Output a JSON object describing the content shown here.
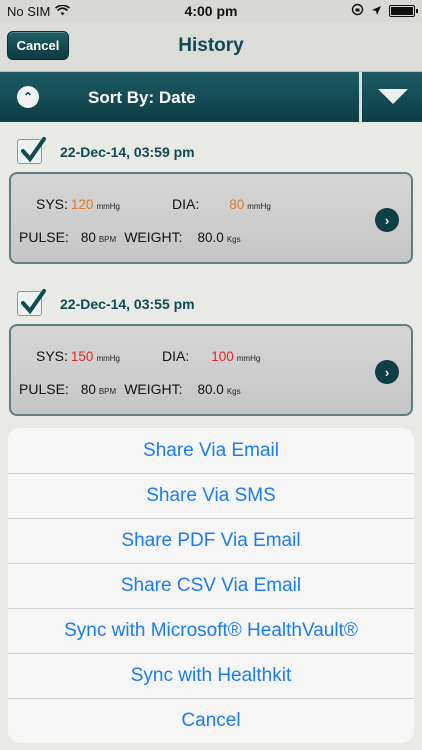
{
  "status": {
    "carrier": "No SIM",
    "time": "4:00 pm"
  },
  "nav": {
    "cancel_label": "Cancel",
    "title": "History"
  },
  "sort": {
    "label": "Sort By: Date"
  },
  "entries": [
    {
      "date": "22-Dec-14, 03:59 pm",
      "sys_label": "SYS:",
      "sys_value": "120",
      "sys_unit": "mmHg",
      "dia_label": "DIA:",
      "dia_value": "80",
      "dia_unit": "mmHg",
      "pulse_label": "PULSE:",
      "pulse_value": "80",
      "pulse_unit": "BPM",
      "weight_label": "WEIGHT:",
      "weight_value": "80.0",
      "weight_unit": "Kgs",
      "sys_color": "#e07a2a",
      "dia_color": "#e07a2a"
    },
    {
      "date": "22-Dec-14, 03:55 pm",
      "sys_label": "SYS:",
      "sys_value": "150",
      "sys_unit": "mmHg",
      "dia_label": "DIA:",
      "dia_value": "100",
      "dia_unit": "mmHg",
      "pulse_label": "PULSE:",
      "pulse_value": "80",
      "pulse_unit": "BPM",
      "weight_label": "WEIGHT:",
      "weight_value": "80.0",
      "weight_unit": "Kgs",
      "sys_color": "#d72a2a",
      "dia_color": "#d72a2a"
    }
  ],
  "action_sheet": {
    "items": [
      "Share Via Email",
      "Share Via SMS",
      "Share PDF Via Email",
      "Share CSV Via Email",
      "Sync with Microsoft® HealthVault®",
      "Sync with Healthkit",
      "Cancel"
    ]
  },
  "colors": {
    "accent": "#0e4a54",
    "sheet_text": "#1a7cf2"
  }
}
